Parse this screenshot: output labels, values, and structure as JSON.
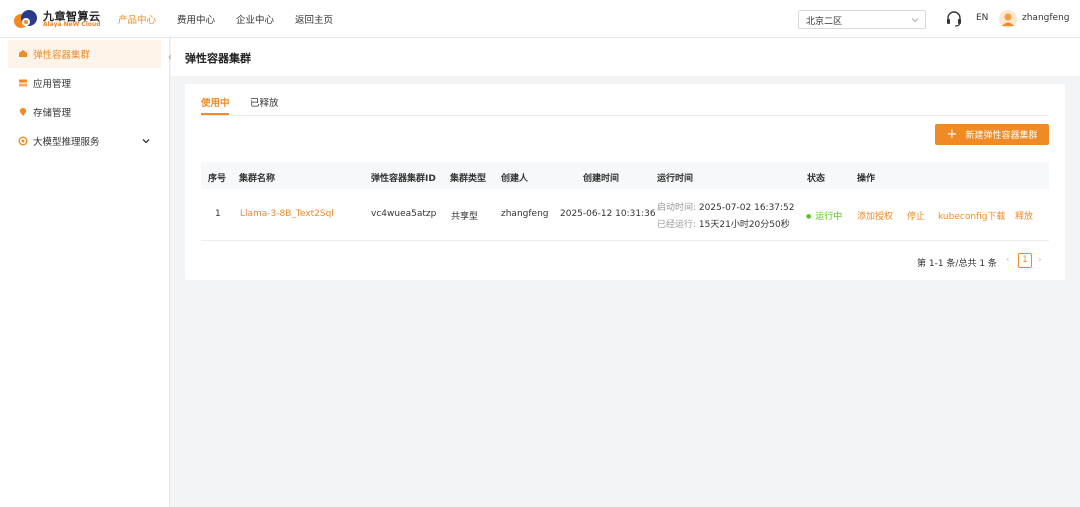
{
  "brand": {
    "name_cn": "九章智算云",
    "name_en": "Alaya NeW Cloud",
    "accent": "#f08a24"
  },
  "nav": {
    "items": [
      {
        "label": "产品中心",
        "active": true
      },
      {
        "label": "费用中心",
        "active": false
      },
      {
        "label": "企业中心",
        "active": false
      },
      {
        "label": "返回主页",
        "active": false
      }
    ]
  },
  "header": {
    "region": "北京二区",
    "lang": "EN",
    "username": "zhangfeng"
  },
  "sidebar": {
    "items": [
      {
        "label": "弹性容器集群",
        "icon": "cluster-icon",
        "active": true
      },
      {
        "label": "应用管理",
        "icon": "app-icon",
        "active": false
      },
      {
        "label": "存储管理",
        "icon": "storage-icon",
        "active": false
      },
      {
        "label": "大模型推理服务",
        "icon": "inference-icon",
        "active": false
      }
    ]
  },
  "page": {
    "title": "弹性容器集群"
  },
  "tabs": [
    {
      "label": "使用中",
      "active": true
    },
    {
      "label": "已释放",
      "active": false
    }
  ],
  "create_button": {
    "label": "新建弹性容器集群"
  },
  "table": {
    "columns": [
      "序号",
      "集群名称",
      "弹性容器集群ID",
      "集群类型",
      "创建人",
      "创建时间",
      "运行时间",
      "状态",
      "操作"
    ],
    "rows": [
      {
        "index": "1",
        "name": "Llama-3-8B_Text2Sql",
        "cluster_id": "vc4wuea5atzp",
        "type": "共享型",
        "creator": "zhangfeng",
        "created_at": "2025-06-12 10:31:36",
        "start_label": "启动时间:",
        "start_time": "2025-07-02 16:37:52",
        "uptime_label": "已经运行:",
        "uptime": "15天21小时20分50秒",
        "status": "运行中",
        "actions": [
          "添加授权",
          "停止",
          "kubeconfig下载",
          "释放"
        ]
      }
    ]
  },
  "pagination": {
    "summary": "第 1-1 条/总共 1 条",
    "current_page": "1"
  }
}
